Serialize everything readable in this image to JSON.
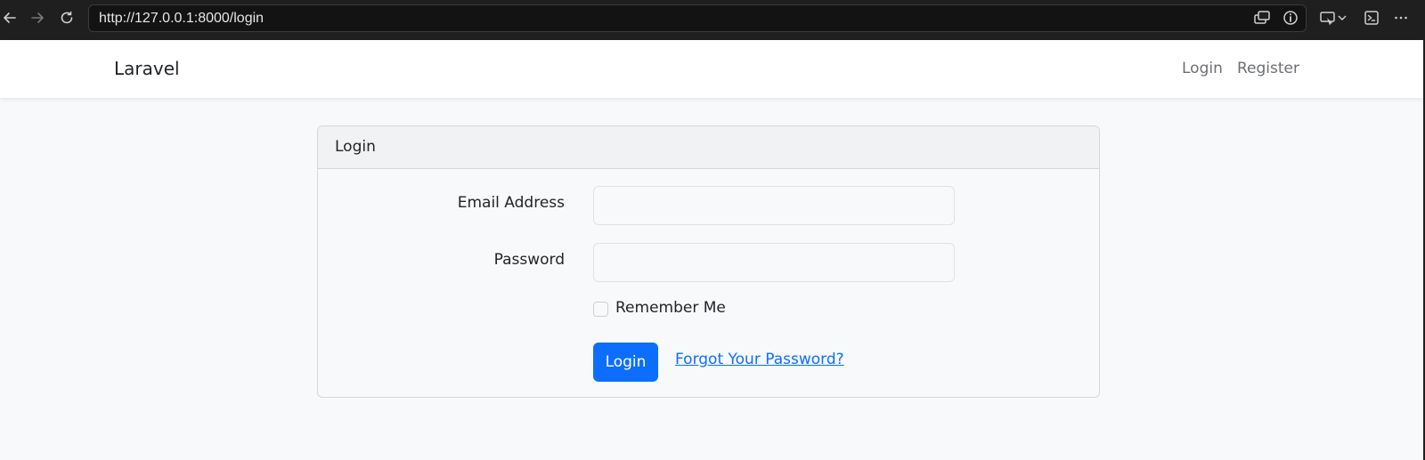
{
  "browser": {
    "url": "http://127.0.0.1:8000/login",
    "icons": [
      "back-arrow-icon",
      "forward-arrow-icon",
      "reload-icon",
      "screen-share-icon",
      "info-icon",
      "cast-icon",
      "chevron-down-icon",
      "terminal-icon",
      "more-icon"
    ]
  },
  "navbar": {
    "brand": "Laravel",
    "links": [
      {
        "label": "Login"
      },
      {
        "label": "Register"
      }
    ]
  },
  "card": {
    "header": "Login",
    "email_label": "Email Address",
    "email_value": "",
    "password_label": "Password",
    "password_value": "",
    "remember_label": "Remember Me",
    "remember_checked": false,
    "submit_label": "Login",
    "forgot_label": "Forgot Your Password?"
  },
  "colors": {
    "primary": "#0d6efd",
    "background": "#f8f9fa",
    "chrome": "#1f1f1f"
  }
}
